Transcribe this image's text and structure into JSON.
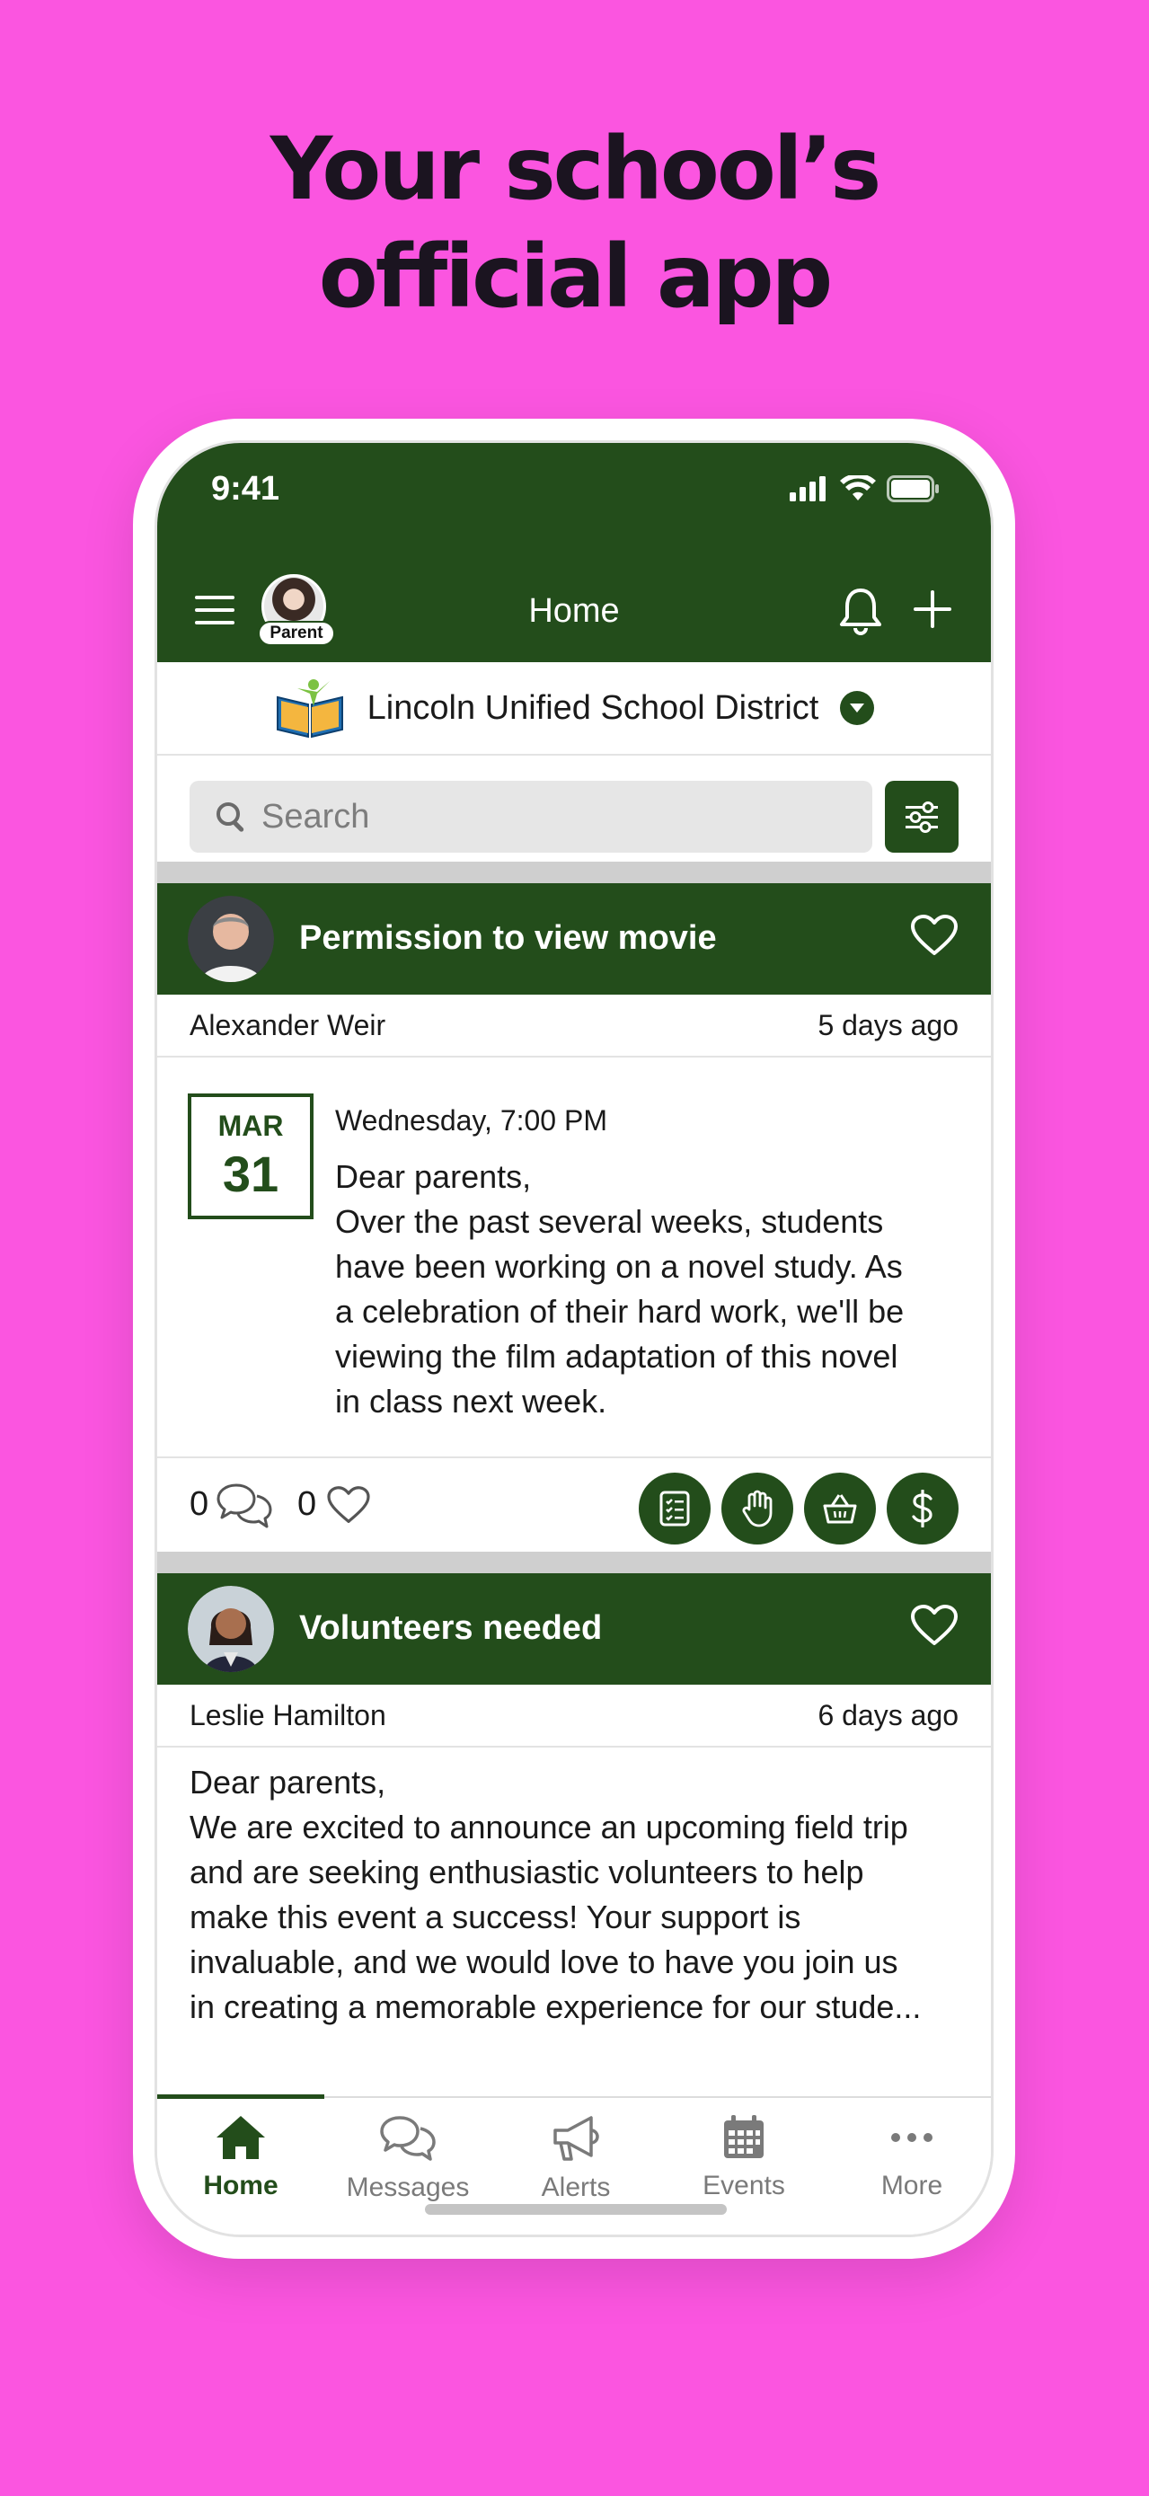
{
  "headline": {
    "line1": "Your school’s",
    "line2": "official app"
  },
  "status_bar": {
    "time": "9:41"
  },
  "app_bar": {
    "title": "Home",
    "role_badge": "Parent"
  },
  "district": {
    "name": "Lincoln Unified School District"
  },
  "search": {
    "placeholder": "Search"
  },
  "posts": [
    {
      "title": "Permission to view movie",
      "author": "Alexander Weir",
      "time_ago": "5 days ago",
      "date_month": "MAR",
      "date_day": "31",
      "event_time": "Wednesday, 7:00 PM",
      "greeting": "Dear parents,",
      "body_lines": [
        "Over the past several weeks, students",
        "have been working on a novel study. As",
        "a celebration of their hard work, we'll be",
        "viewing the film adaptation of this novel",
        "in class next week."
      ],
      "comment_count": "0",
      "like_count": "0"
    },
    {
      "title": "Volunteers needed",
      "author": "Leslie Hamilton",
      "time_ago": "6 days ago",
      "greeting": "Dear parents,",
      "body_lines": [
        "We are excited to announce an upcoming field trip",
        "and are seeking enthusiastic volunteers to help",
        "make this event a success! Your support is",
        "invaluable, and we would love to have you join us",
        "in creating a memorable experience for our stude..."
      ]
    }
  ],
  "tabs": [
    {
      "label": "Home",
      "icon": "home-icon"
    },
    {
      "label": "Messages",
      "icon": "messages-icon"
    },
    {
      "label": "Alerts",
      "icon": "megaphone-icon"
    },
    {
      "label": "Events",
      "icon": "calendar-icon"
    },
    {
      "label": "More",
      "icon": "more-icon"
    }
  ],
  "colors": {
    "background": "#fb55e0",
    "brand_green": "#234d1b",
    "headline": "#1b1420"
  }
}
